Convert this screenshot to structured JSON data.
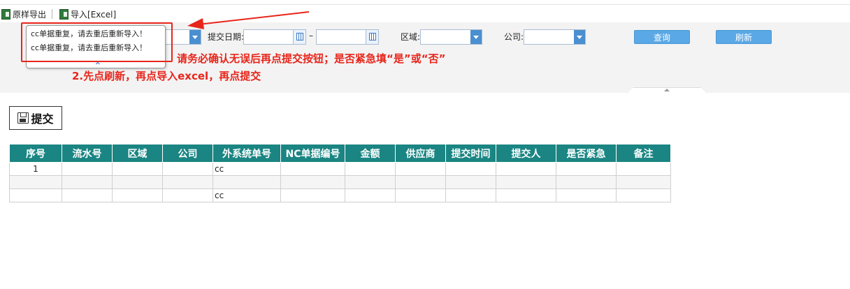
{
  "toolbar": {
    "export_label": "原样导出",
    "import_label": "导入[Excel]"
  },
  "filters": {
    "submit_date_label": "提交日期:",
    "date_separator": "–",
    "region_label": "区域:",
    "company_label": "公司:",
    "query_button": "查询",
    "refresh_button": "刷新"
  },
  "tooltip": {
    "lines": [
      "cc单据重复，请去重后重新导入！",
      "cc单据重复，请去重后重新导入！"
    ]
  },
  "instructions": {
    "line1": "请务必确认无误后再点提交按钮；是否紧急填“是”或“否”",
    "line2": "2.先点刷新，再点导入excel，再点提交"
  },
  "submit_button_label": "提交",
  "table": {
    "columns": [
      "序号",
      "流水号",
      "区域",
      "公司",
      "外系统单号",
      "NC单据编号",
      "金额",
      "供应商",
      "提交时间",
      "提交人",
      "是否紧急",
      "备注"
    ],
    "rows": [
      [
        "1",
        "",
        "",
        "",
        "cc",
        "",
        "",
        "",
        "",
        "",
        "",
        ""
      ],
      [
        "",
        "",
        "",
        "",
        "",
        "",
        "",
        "",
        "",
        "",
        "",
        ""
      ],
      [
        "",
        "",
        "",
        "",
        "cc",
        "",
        "",
        "",
        "",
        "",
        "",
        ""
      ]
    ]
  },
  "colors": {
    "header_bg": "#1a8582",
    "instruction_red": "#e8251b",
    "button_blue": "#5aa8e6"
  }
}
